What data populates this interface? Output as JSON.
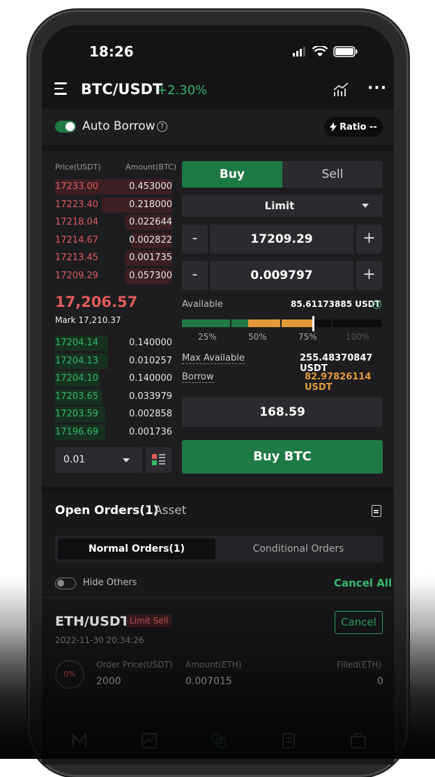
{
  "status_bar": {
    "time": "18:26"
  },
  "header": {
    "pair": "BTC/USDT",
    "change": "+2.30%"
  },
  "auto_borrow": {
    "label": "Auto Borrow",
    "enabled": true,
    "ratio_label": "Ratio --"
  },
  "order_book": {
    "price_header": "Price(USDT)",
    "amount_header": "Amount(BTC)",
    "asks": [
      {
        "price": "17233.00",
        "amount": "0.453000",
        "depth": 1.0
      },
      {
        "price": "17223.40",
        "amount": "0.218000",
        "depth": 0.6
      },
      {
        "price": "17218.04",
        "amount": "0.022644",
        "depth": 0.4
      },
      {
        "price": "17214.67",
        "amount": "0.002822",
        "depth": 0.35
      },
      {
        "price": "17213.45",
        "amount": "0.001735",
        "depth": 0.4
      },
      {
        "price": "17209.29",
        "amount": "0.057300",
        "depth": 0.4
      }
    ],
    "last_price": "17,206.57",
    "mark_price": "Mark  17,210.37",
    "bids": [
      {
        "price": "17204.14",
        "amount": "0.140000",
        "depth": 0.45
      },
      {
        "price": "17204.13",
        "amount": "0.010257",
        "depth": 0.45
      },
      {
        "price": "17204.10",
        "amount": "0.140000",
        "depth": 0.38
      },
      {
        "price": "17203.65",
        "amount": "0.033979",
        "depth": 0.4
      },
      {
        "price": "17203.59",
        "amount": "0.002858",
        "depth": 0.43
      },
      {
        "price": "17196.69",
        "amount": "0.001736",
        "depth": 0.43
      }
    ],
    "precision": "0.01"
  },
  "trade_form": {
    "buy_tab": "Buy",
    "sell_tab": "Sell",
    "order_type": "Limit",
    "price": "17209.29",
    "amount": "0.009797",
    "minus": "-",
    "plus": "+",
    "available_label": "Available",
    "available_value": "85.61173885 USDT",
    "slider_value_percent": 75,
    "slider_marks": [
      "25%",
      "50%",
      "75%",
      "100%"
    ],
    "max_available_label": "Max Available",
    "max_available_value": "255.48370847 USDT",
    "borrow_label": "Borrow",
    "borrow_value": "82.97826114 USDT",
    "total": "168.59",
    "submit_label": "Buy BTC"
  },
  "orders": {
    "tab_open": "Open Orders(1)",
    "tab_asset": "Asset",
    "sub_tab_normal": "Normal Orders(1)",
    "sub_tab_conditional": "Conditional Orders",
    "hide_others": "Hide Others",
    "cancel_all": "Cancel All",
    "items": [
      {
        "pair": "ETH/USDT",
        "badge": "Limit Sell",
        "time": "2022-11-30 20:34:26",
        "progress": "0%",
        "price_header": "Order Price(USDT)",
        "price": "2000",
        "amount_header": "Amount(ETH)",
        "amount": "0.007015",
        "filled_header": "Filled(ETH)",
        "filled": "0",
        "cancel_label": "Cancel"
      }
    ]
  },
  "colors": {
    "green": "#35b86a",
    "red": "#e05a5a",
    "orange": "#e39a3b",
    "background": "#141416"
  }
}
